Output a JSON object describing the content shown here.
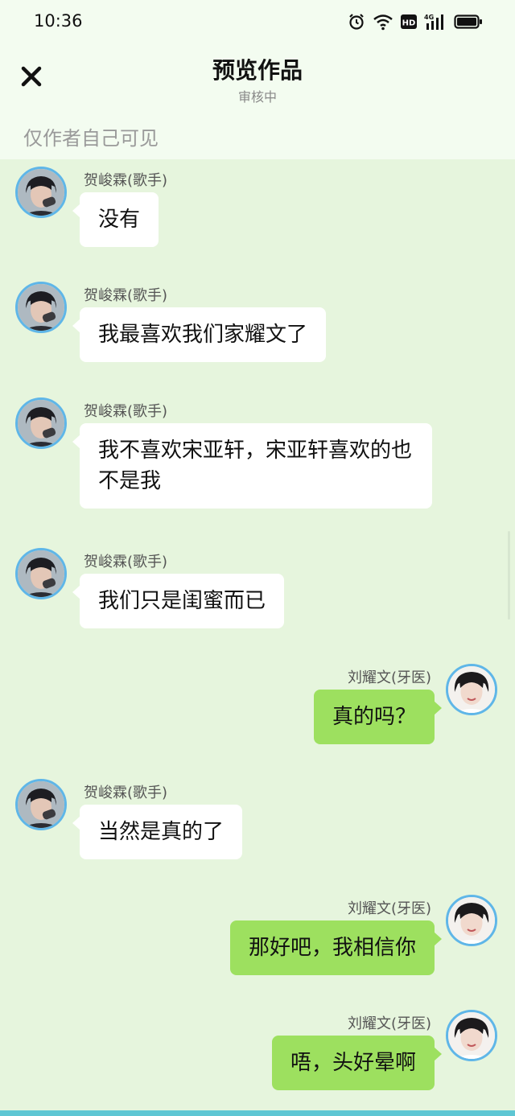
{
  "status_bar": {
    "time": "10:36",
    "icons": [
      "alarm-icon",
      "wifi-icon",
      "hd-icon",
      "signal-4g-icon",
      "battery-icon"
    ],
    "hd_label": "HD",
    "network_label": "4G"
  },
  "header": {
    "close_icon": "close-icon",
    "title": "预览作品",
    "subtitle": "审核中",
    "visibility_note": "仅作者自己可见"
  },
  "messages": [
    {
      "side": "left",
      "sender": "贺峻霖(歌手)",
      "text": "没有"
    },
    {
      "side": "left",
      "sender": "贺峻霖(歌手)",
      "text": "我最喜欢我们家耀文了"
    },
    {
      "side": "left",
      "sender": "贺峻霖(歌手)",
      "text": "我不喜欢宋亚轩，宋亚轩喜欢的也不是我"
    },
    {
      "side": "left",
      "sender": "贺峻霖(歌手)",
      "text": "我们只是闺蜜而已"
    },
    {
      "side": "right",
      "sender": "刘耀文(牙医)",
      "text": "真的吗？"
    },
    {
      "side": "left",
      "sender": "贺峻霖(歌手)",
      "text": "当然是真的了"
    },
    {
      "side": "right",
      "sender": "刘耀文(牙医)",
      "text": "那好吧，我相信你"
    },
    {
      "side": "right",
      "sender": "刘耀文(牙医)",
      "text": "唔，头好晕啊"
    }
  ],
  "colors": {
    "background": "#e6f5dd",
    "header_background": "#f3fcf0",
    "incoming_bubble": "#ffffff",
    "outgoing_bubble": "#9de05f",
    "avatar_ring": "#5fb6e8",
    "bottom_accent": "#5ec6d3"
  }
}
